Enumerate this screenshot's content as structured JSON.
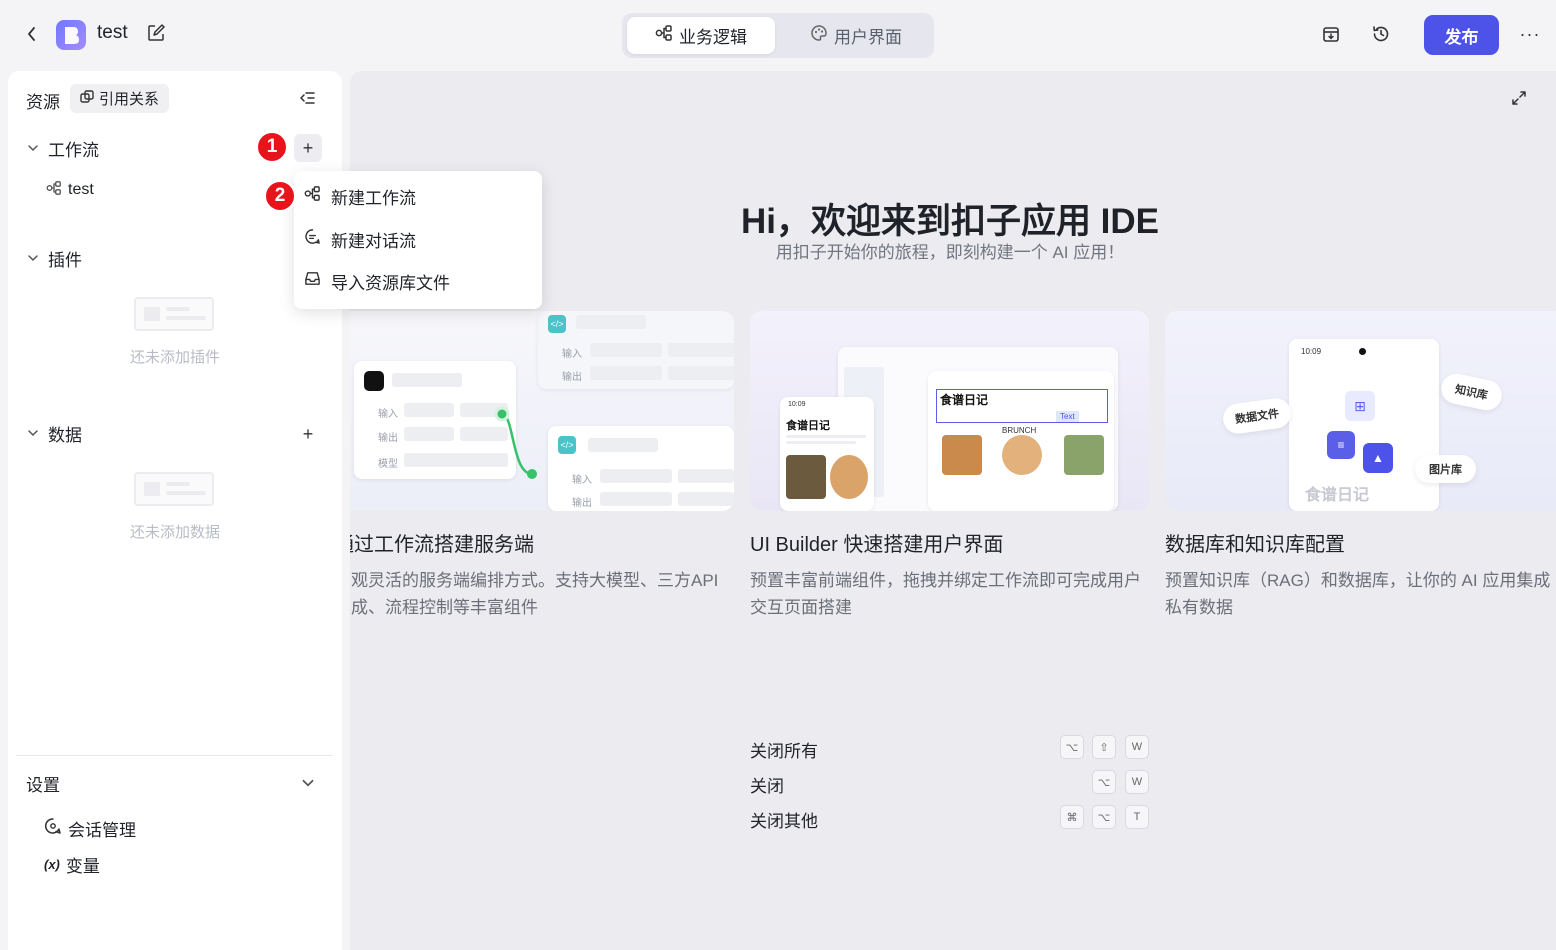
{
  "app": {
    "name": "test"
  },
  "mode_switch": {
    "tabs": [
      {
        "label": "业务逻辑",
        "active": true
      },
      {
        "label": "用户界面",
        "active": false
      }
    ]
  },
  "toolbar": {
    "publish_label": "发布",
    "more_label": "···"
  },
  "sidebar": {
    "title": "资源",
    "ref_button": "引用关系",
    "sections": {
      "workflow": {
        "label": "工作流",
        "items": [
          {
            "label": "test"
          }
        ]
      },
      "plugin": {
        "label": "插件",
        "empty_text": "还未添加插件"
      },
      "data": {
        "label": "数据",
        "empty_text": "还未添加数据"
      }
    },
    "settings": {
      "title": "设置",
      "items": [
        {
          "label": "会话管理",
          "icon": "chat-settings-icon"
        },
        {
          "label": "变量",
          "icon": "variable-icon"
        }
      ]
    }
  },
  "dropdown": {
    "items": [
      {
        "label": "新建工作流",
        "icon": "workflow-icon"
      },
      {
        "label": "新建对话流",
        "icon": "chat-icon"
      },
      {
        "label": "导入资源库文件",
        "icon": "inbox-icon"
      }
    ]
  },
  "badges": [
    "1",
    "2"
  ],
  "welcome": {
    "title": "Hi，欢迎来到扣子应用 IDE",
    "subtitle": "用扣子开始你的旅程，即刻构建一个 AI 应用！"
  },
  "cards": [
    {
      "title": "通过工作流搭建服务端",
      "desc": "可观灵活的服务端编排方式。支持大模型、三方API集成、流程控制等丰富组件",
      "illustration": {
        "input_label": "输入",
        "output_label": "输出",
        "model_label": "模型"
      }
    },
    {
      "title": "UI Builder 快速搭建用户界面",
      "desc": "预置丰富前端组件，拖拽并绑定工作流即可完成用户交互页面搭建",
      "illustration": {
        "recipe_title": "食谱日记",
        "phone_time": "10:09",
        "text_tag": "Text",
        "brunch_label": "BRUNCH"
      }
    },
    {
      "title": "数据库和知识库配置",
      "desc": "预置知识库（RAG）和数据库，让你的 AI 应用集成私有数据",
      "illustration": {
        "phone_time": "10:09",
        "data_file": "数据文件",
        "knowledge": "知识库",
        "image_lib": "图片库",
        "recipe_title": "食谱日记"
      }
    }
  ],
  "shortcuts": [
    {
      "label": "关闭所有",
      "keys": [
        "⌥",
        "⇧",
        "W"
      ]
    },
    {
      "label": "关闭",
      "keys": [
        "⌥",
        "W"
      ]
    },
    {
      "label": "关闭其他",
      "keys": [
        "⌘",
        "⌥",
        "T"
      ]
    }
  ],
  "colors": {
    "accent": "#4d53e8",
    "badge": "#e8141c",
    "node_green": "#35c26a"
  }
}
